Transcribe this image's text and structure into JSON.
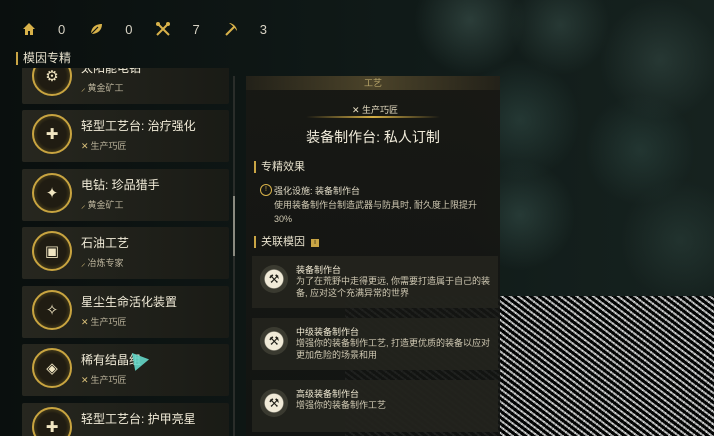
{
  "resources": [
    {
      "icon": "home-icon",
      "value": "0"
    },
    {
      "icon": "leaf-icon",
      "value": "0"
    },
    {
      "icon": "crossed-tools-icon",
      "value": "7"
    },
    {
      "icon": "pickaxe-icon",
      "value": "3"
    }
  ],
  "panel": {
    "title": "模因专精"
  },
  "items": [
    {
      "name": "太阳能电钻",
      "sub": "黄金矿工"
    },
    {
      "name": "轻型工艺台: 治疗强化",
      "sub": "生产巧匠"
    },
    {
      "name": "电钻: 珍品猎手",
      "sub": "黄金矿工"
    },
    {
      "name": "石油工艺",
      "sub": "冶炼专家"
    },
    {
      "name": "星尘生命活化装置",
      "sub": "生产巧匠"
    },
    {
      "name": "稀有结晶组",
      "sub": "生产巧匠"
    },
    {
      "name": "轻型工艺台: 护甲亮星",
      "sub": ""
    }
  ],
  "detail": {
    "tab": "工艺",
    "role": "生产巧匠",
    "title": "装备制作台: 私人订制",
    "effects_heading": "专精效果",
    "effect_name": "强化设施: 装备制作台",
    "effect_desc": "使用装备制作台制造武器与防具时, 耐久度上限提升30%",
    "related_heading": "关联模因",
    "related": [
      {
        "name": "装备制作台",
        "desc": "为了在荒野中走得更远, 你需要打造属于自己的装备, 应对这个充满异常的世界"
      },
      {
        "name": "中级装备制作台",
        "desc": "增强你的装备制作工艺, 打造更优质的装备以应对更加危险的场景和用"
      },
      {
        "name": "高级装备制作台",
        "desc": "增强你的装备制作工艺"
      }
    ]
  },
  "colors": {
    "accent": "#c9a545",
    "cursor": "#64d6c8"
  }
}
